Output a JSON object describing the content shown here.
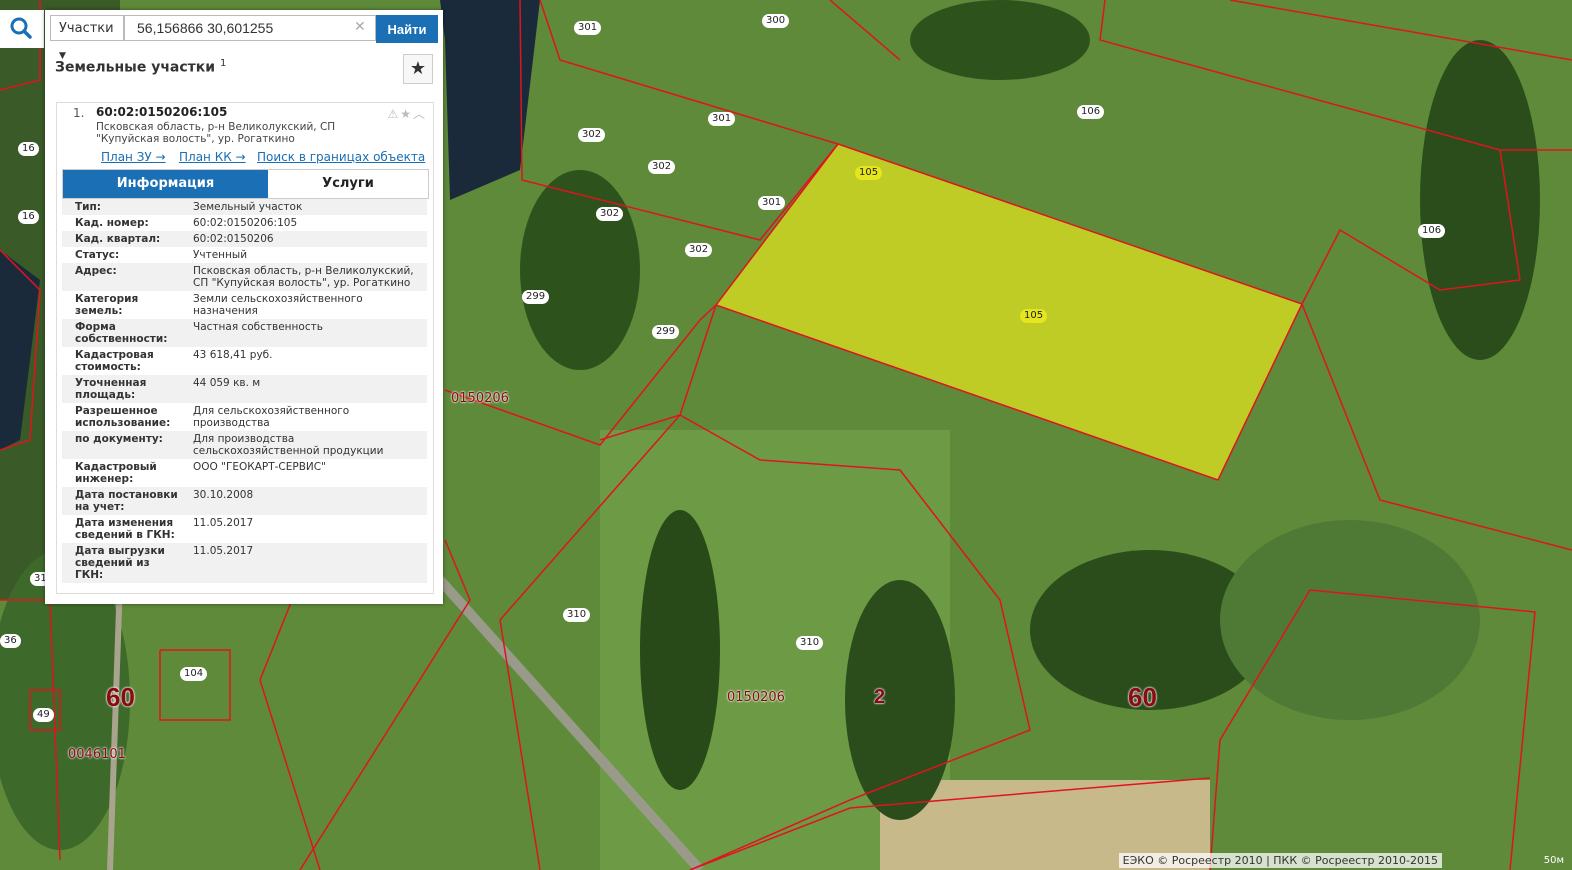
{
  "search": {
    "type_label": "Участки",
    "query": "56,156866 30,601255",
    "find_label": "Найти"
  },
  "panel": {
    "title": "Земельные участки",
    "count": "1"
  },
  "card": {
    "index": "1.",
    "cadastral_number": "60:02:0150206:105",
    "address_line": "Псковская область, р-н Великолукский, СП \"Купуйская волость\", ур. Рогаткино",
    "links": [
      "План ЗУ →",
      "План КК →",
      "Поиск в границах объекта →"
    ],
    "tabs": [
      "Информация",
      "Услуги"
    ],
    "rows": [
      {
        "k": "Тип:",
        "v": "Земельный участок"
      },
      {
        "k": "Кад. номер:",
        "v": "60:02:0150206:105"
      },
      {
        "k": "Кад. квартал:",
        "v": "60:02:0150206"
      },
      {
        "k": "Статус:",
        "v": "Учтенный"
      },
      {
        "k": "Адрес:",
        "v": "Псковская область, р-н Великолукский, СП \"Купуйская волость\", ур. Рогаткино"
      },
      {
        "k": "Категория земель:",
        "v": "Земли сельскохозяйственного назначения"
      },
      {
        "k": "Форма собственности:",
        "v": "Частная собственность"
      },
      {
        "k": "Кадастровая стоимость:",
        "v": "43 618,41 руб."
      },
      {
        "k": "Уточненная площадь:",
        "v": "44 059 кв. м"
      },
      {
        "k": "Разрешенное использование:",
        "v": "Для сельскохозяйственного производства"
      },
      {
        "k": "по документу:",
        "v": "Для производства сельскохозяйственной продукции"
      },
      {
        "k": "Кадастровый инженер:",
        "v": "ООО \"ГЕОКАРТ-СЕРВИС\""
      },
      {
        "k": "Дата постановки на учет:",
        "v": "30.10.2008"
      },
      {
        "k": "Дата изменения сведений в ГКН:",
        "v": "11.05.2017"
      },
      {
        "k": "Дата выгрузки сведений из ГКН:",
        "v": "11.05.2017"
      }
    ]
  },
  "map": {
    "parcel_labels": [
      "301",
      "300",
      "302",
      "106",
      "105",
      "299",
      "310",
      "104",
      "16",
      "31",
      "36",
      "49"
    ],
    "quarter_labels": [
      "0150206",
      "0046101"
    ],
    "district_labels": [
      "60",
      "2"
    ],
    "highlight_color": "#e6e61e",
    "boundary_color": "#e0141e"
  },
  "footer": {
    "attribution": "ЕЭКО © Росреестр 2010 | ПКК © Росреестр 2010-2015",
    "scale": "50м"
  }
}
